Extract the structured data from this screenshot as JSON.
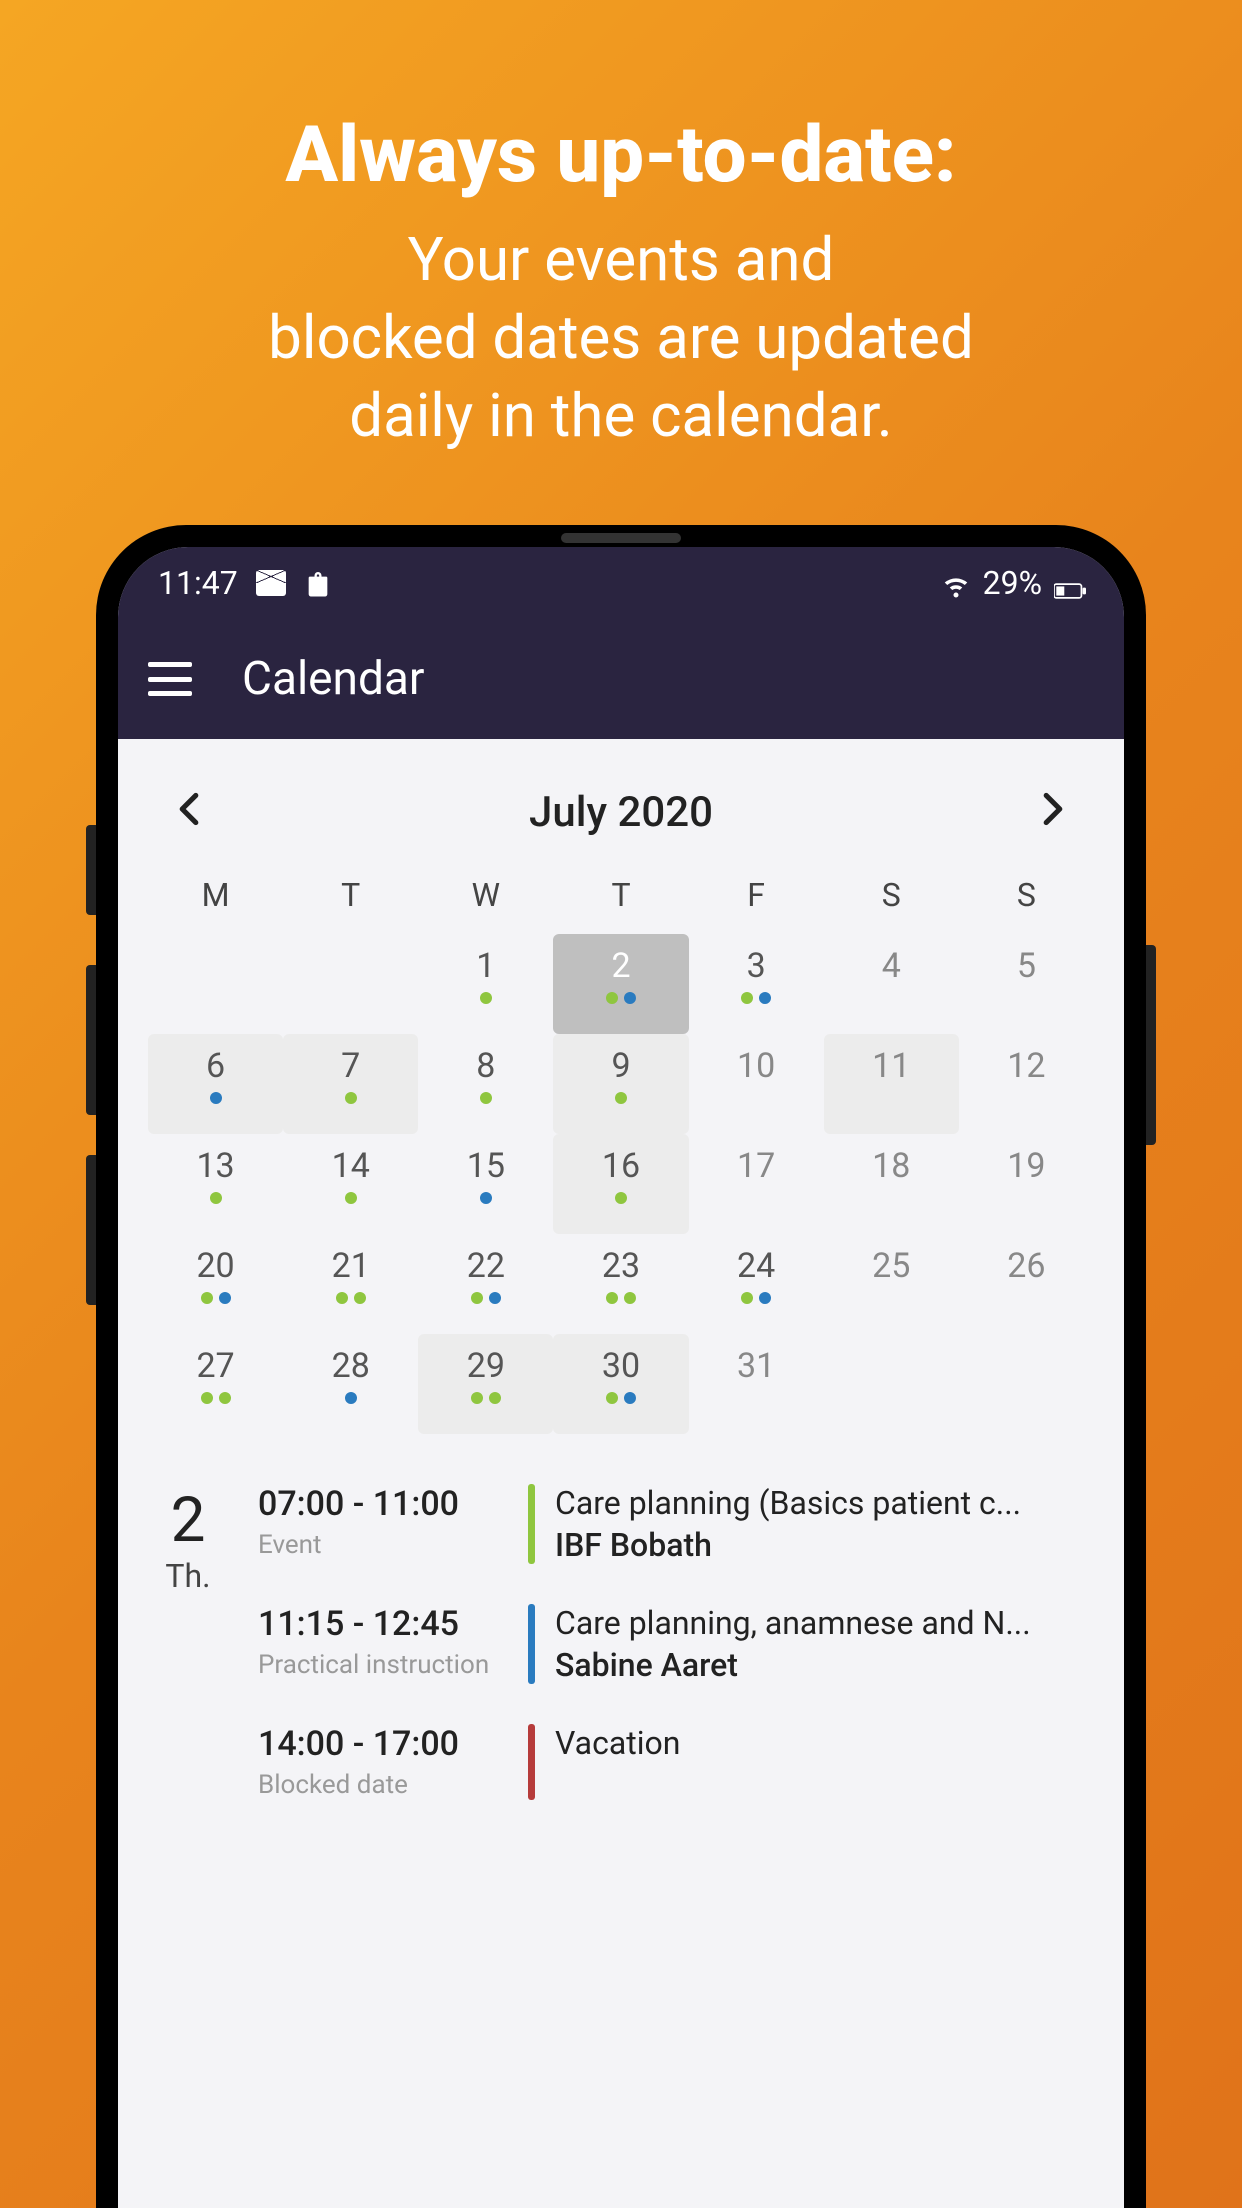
{
  "promo": {
    "title": "Always up-to-date:",
    "subtitle": "Your events and\nblocked dates are updated\ndaily in the calendar."
  },
  "status_bar": {
    "time": "11:47",
    "battery": "29%"
  },
  "app_bar": {
    "title": "Calendar"
  },
  "calendar": {
    "month_label": "July 2020",
    "dow": [
      "M",
      "T",
      "W",
      "T",
      "F",
      "S",
      "S"
    ],
    "weeks": [
      [
        {
          "n": "",
          "dim": false,
          "sel": false,
          "d": []
        },
        {
          "n": "",
          "dim": false,
          "sel": false,
          "d": []
        },
        {
          "n": "1",
          "dim": false,
          "sel": false,
          "d": [
            "g"
          ]
        },
        {
          "n": "2",
          "dim": false,
          "sel": true,
          "d": [
            "g",
            "b"
          ]
        },
        {
          "n": "3",
          "dim": false,
          "sel": false,
          "d": [
            "g",
            "b"
          ]
        },
        {
          "n": "4",
          "dim": false,
          "sel": false,
          "d": []
        },
        {
          "n": "5",
          "dim": false,
          "sel": false,
          "d": []
        }
      ],
      [
        {
          "n": "6",
          "dim": true,
          "sel": false,
          "d": [
            "b"
          ]
        },
        {
          "n": "7",
          "dim": true,
          "sel": false,
          "d": [
            "g"
          ]
        },
        {
          "n": "8",
          "dim": false,
          "sel": false,
          "d": [
            "g"
          ]
        },
        {
          "n": "9",
          "dim": true,
          "sel": false,
          "d": [
            "g"
          ]
        },
        {
          "n": "10",
          "dim": false,
          "sel": false,
          "d": []
        },
        {
          "n": "11",
          "dim": true,
          "sel": false,
          "d": []
        },
        {
          "n": "12",
          "dim": false,
          "sel": false,
          "d": []
        }
      ],
      [
        {
          "n": "13",
          "dim": false,
          "sel": false,
          "d": [
            "g"
          ]
        },
        {
          "n": "14",
          "dim": false,
          "sel": false,
          "d": [
            "g"
          ]
        },
        {
          "n": "15",
          "dim": false,
          "sel": false,
          "d": [
            "b"
          ]
        },
        {
          "n": "16",
          "dim": true,
          "sel": false,
          "d": [
            "g"
          ]
        },
        {
          "n": "17",
          "dim": false,
          "sel": false,
          "d": []
        },
        {
          "n": "18",
          "dim": false,
          "sel": false,
          "d": []
        },
        {
          "n": "19",
          "dim": false,
          "sel": false,
          "d": []
        }
      ],
      [
        {
          "n": "20",
          "dim": false,
          "sel": false,
          "d": [
            "g",
            "b"
          ]
        },
        {
          "n": "21",
          "dim": false,
          "sel": false,
          "d": [
            "g",
            "g"
          ]
        },
        {
          "n": "22",
          "dim": false,
          "sel": false,
          "d": [
            "g",
            "b"
          ]
        },
        {
          "n": "23",
          "dim": false,
          "sel": false,
          "d": [
            "g",
            "g"
          ]
        },
        {
          "n": "24",
          "dim": false,
          "sel": false,
          "d": [
            "g",
            "b"
          ]
        },
        {
          "n": "25",
          "dim": false,
          "sel": false,
          "d": []
        },
        {
          "n": "26",
          "dim": false,
          "sel": false,
          "d": []
        }
      ],
      [
        {
          "n": "27",
          "dim": false,
          "sel": false,
          "d": [
            "g",
            "g"
          ]
        },
        {
          "n": "28",
          "dim": false,
          "sel": false,
          "d": [
            "b"
          ]
        },
        {
          "n": "29",
          "dim": true,
          "sel": false,
          "d": [
            "g",
            "g"
          ]
        },
        {
          "n": "30",
          "dim": true,
          "sel": false,
          "d": [
            "g",
            "b"
          ]
        },
        {
          "n": "31",
          "dim": false,
          "sel": false,
          "d": []
        },
        {
          "n": "",
          "dim": false,
          "sel": false,
          "d": []
        },
        {
          "n": "",
          "dim": false,
          "sel": false,
          "d": []
        }
      ]
    ]
  },
  "selected_day": {
    "num": "2",
    "dow": "Th.",
    "events": [
      {
        "time": "07:00 - 11:00",
        "type": "Event",
        "bar": "g",
        "title": "Care planning (Basics patient c...",
        "sub": "IBF Bobath"
      },
      {
        "time": "11:15 - 12:45",
        "type": "Practical instruction",
        "bar": "b",
        "title": "Care planning, anamnese and N...",
        "sub": "Sabine Aaret"
      },
      {
        "time": "14:00 - 17:00",
        "type": "Blocked date",
        "bar": "r",
        "title": "Vacation",
        "sub": ""
      }
    ]
  }
}
